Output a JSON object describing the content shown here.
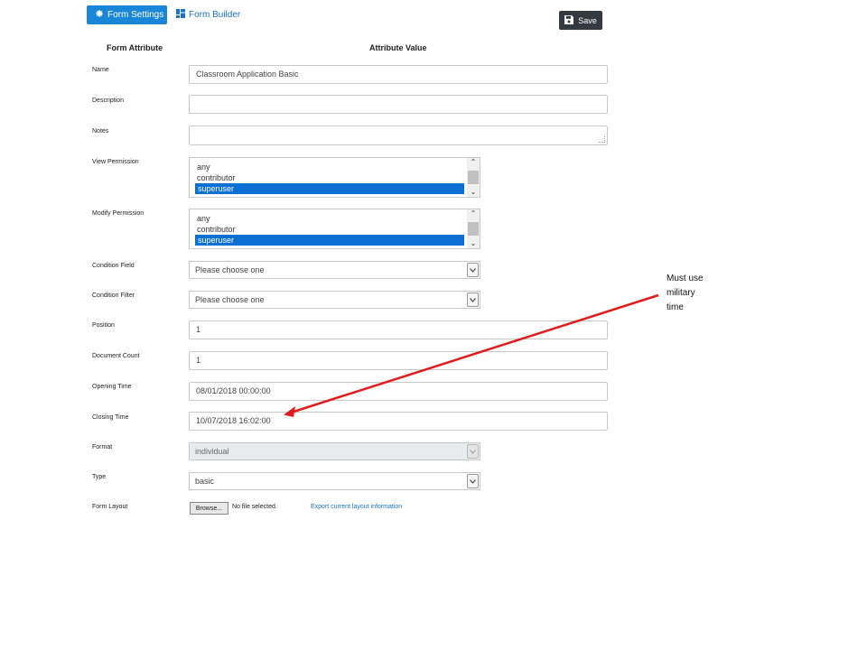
{
  "tabs": {
    "form_settings": "Form Settings",
    "form_builder": "Form Builder"
  },
  "toolbar": {
    "save_label": "Save"
  },
  "headers": {
    "attribute": "Form Attribute",
    "value": "Attribute Value"
  },
  "fields": {
    "name": {
      "label": "Name",
      "value": "Classroom Application Basic"
    },
    "description": {
      "label": "Description",
      "value": ""
    },
    "notes": {
      "label": "Notes",
      "value": ""
    },
    "view_permission": {
      "label": "View Permission",
      "options": [
        "any",
        "contributor",
        "superuser"
      ],
      "selected": "superuser"
    },
    "modify_permission": {
      "label": "Modify Permission",
      "options": [
        "any",
        "contributor",
        "superuser"
      ],
      "selected": "superuser"
    },
    "condition_field": {
      "label": "Condition Field",
      "value": "Please choose one"
    },
    "condition_filter": {
      "label": "Condition Filter",
      "value": "Please choose one"
    },
    "position": {
      "label": "Position",
      "value": "1"
    },
    "document_count": {
      "label": "Document Count",
      "value": "1"
    },
    "opening_time": {
      "label": "Opening Time",
      "value": "08/01/2018 00:00:00"
    },
    "closing_time": {
      "label": "Closing Time",
      "value": "10/07/2018 16:02:00"
    },
    "format": {
      "label": "Format",
      "value": "individual",
      "disabled": true
    },
    "type": {
      "label": "Type",
      "value": "basic"
    },
    "form_layout": {
      "label": "Form Layout",
      "browse_label": "Browse...",
      "file_status": "No file selected.",
      "export_link": "Export current layout information"
    }
  },
  "annotation": {
    "text_line1": "Must use",
    "text_line2": "military",
    "text_line3": "time",
    "arrow_color": "#e21b1b"
  },
  "colors": {
    "primary": "#1a86d8",
    "selected_option": "#0b6fd4",
    "save_button": "#343a40",
    "link": "#1a73c9"
  },
  "icons": {
    "form_settings": "gear-icon",
    "form_builder": "dashboard-icon",
    "save": "floppy-disk-icon"
  }
}
